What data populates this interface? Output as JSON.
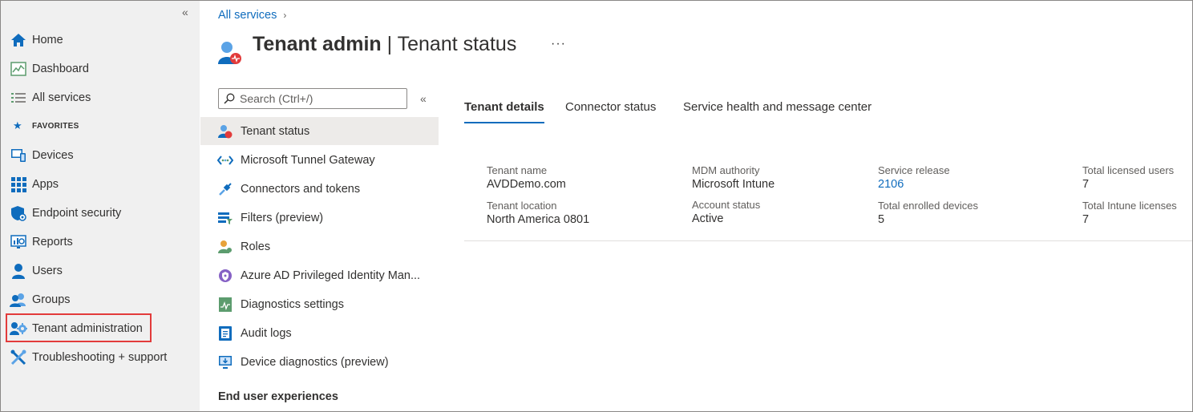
{
  "leftnav": {
    "items": [
      {
        "label": "Home",
        "icon": "home-icon"
      },
      {
        "label": "Dashboard",
        "icon": "dashboard-icon"
      },
      {
        "label": "All services",
        "icon": "list-icon"
      },
      {
        "label": "Devices",
        "icon": "devices-icon"
      },
      {
        "label": "Apps",
        "icon": "apps-grid-icon"
      },
      {
        "label": "Endpoint security",
        "icon": "shield-icon"
      },
      {
        "label": "Reports",
        "icon": "reports-icon"
      },
      {
        "label": "Users",
        "icon": "user-icon"
      },
      {
        "label": "Groups",
        "icon": "groups-icon"
      },
      {
        "label": "Tenant administration",
        "icon": "tenant-admin-gear-icon"
      },
      {
        "label": "Troubleshooting + support",
        "icon": "tools-icon"
      }
    ],
    "favorites_label": "FAVORITES",
    "collapse_glyph": "«"
  },
  "breadcrumb": {
    "link": "All services",
    "chevron": "›"
  },
  "header": {
    "title_bold": "Tenant admin",
    "title_sep": " | ",
    "title_rest": "Tenant status",
    "more": "···"
  },
  "menu": {
    "search_placeholder": "Search (Ctrl+/)",
    "collapse_glyph": "«",
    "items": [
      {
        "label": "Tenant status",
        "active": true
      },
      {
        "label": "Microsoft Tunnel Gateway"
      },
      {
        "label": "Connectors and tokens"
      },
      {
        "label": "Filters (preview)"
      },
      {
        "label": "Roles"
      },
      {
        "label": "Azure AD Privileged Identity Man..."
      },
      {
        "label": "Diagnostics settings"
      },
      {
        "label": "Audit logs"
      },
      {
        "label": "Device diagnostics (preview)"
      }
    ],
    "section": "End user experiences"
  },
  "tabs": [
    {
      "label": "Tenant details",
      "selected": true
    },
    {
      "label": "Connector status"
    },
    {
      "label": "Service health and message center"
    }
  ],
  "details": {
    "tenant_name_label": "Tenant name",
    "tenant_name": "AVDDemo.com",
    "tenant_location_label": "Tenant location",
    "tenant_location": "North America 0801",
    "mdm_authority_label": "MDM authority",
    "mdm_authority": "Microsoft Intune",
    "account_status_label": "Account status",
    "account_status": "Active",
    "service_release_label": "Service release",
    "service_release": "2106",
    "total_enrolled_label": "Total enrolled devices",
    "total_enrolled": "5",
    "total_licensed_label": "Total licensed users",
    "total_licensed": "7",
    "total_intune_label": "Total Intune licenses",
    "total_intune": "7"
  },
  "colors": {
    "accent": "#0f6cbd",
    "highlight": "#e23b3b",
    "nav_bg": "#f0f0f0"
  }
}
